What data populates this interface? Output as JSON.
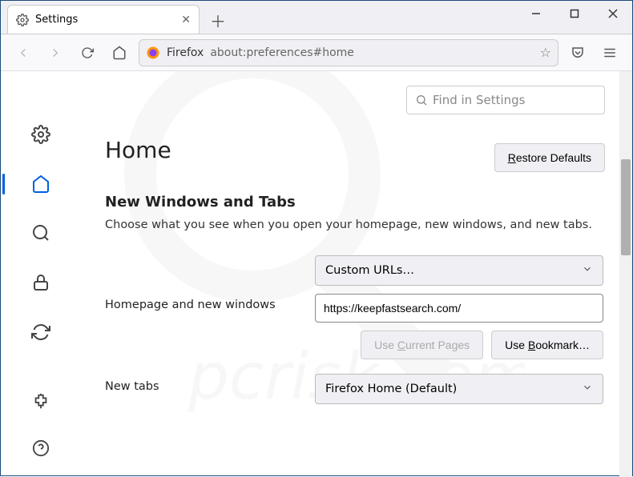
{
  "tab": {
    "title": "Settings"
  },
  "toolbar": {
    "identity_label": "Firefox",
    "url": "about:preferences#home"
  },
  "search": {
    "placeholder": "Find in Settings"
  },
  "header": {
    "title": "Home",
    "restore_label": "Restore Defaults"
  },
  "section": {
    "title": "New Windows and Tabs",
    "description": "Choose what you see when you open your homepage, new windows, and new tabs."
  },
  "homepage": {
    "label": "Homepage and new windows",
    "select_value": "Custom URLs…",
    "url_value": "https://keepfastsearch.com/",
    "use_current_label_pre": "Use ",
    "use_current_accesskey": "C",
    "use_current_label_post": "urrent Pages",
    "use_bookmark_label_pre": "Use ",
    "use_bookmark_accesskey": "B",
    "use_bookmark_label_post": "ookmark…"
  },
  "newtabs": {
    "label": "New tabs",
    "select_value": "Firefox Home (Default)"
  },
  "watermark": "pcrisk.com"
}
